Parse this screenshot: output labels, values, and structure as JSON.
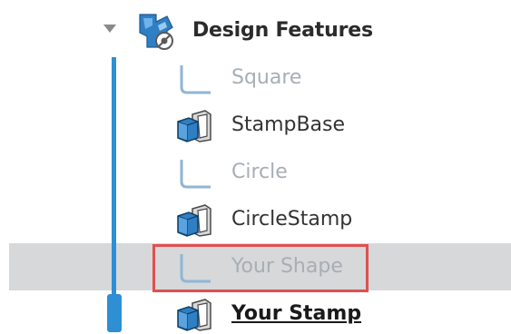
{
  "tree": {
    "folder": {
      "label": "Design Features",
      "icon": "design-features-folder-icon",
      "expanded": true
    },
    "items": [
      {
        "label": "Square",
        "type": "sketch",
        "icon": "sketch-icon",
        "suppressed": true
      },
      {
        "label": "StampBase",
        "type": "solid",
        "icon": "solid-body-icon",
        "suppressed": false
      },
      {
        "label": "Circle",
        "type": "sketch",
        "icon": "sketch-icon",
        "suppressed": true
      },
      {
        "label": "CircleStamp",
        "type": "solid",
        "icon": "solid-body-icon",
        "suppressed": false
      },
      {
        "label": "Your Shape",
        "type": "sketch",
        "icon": "sketch-icon",
        "suppressed": true,
        "selected": true,
        "annotated": true
      },
      {
        "label": "Your Stamp",
        "type": "solid",
        "icon": "solid-body-icon",
        "suppressed": false,
        "active": true
      }
    ]
  },
  "colors": {
    "tree_line": "#2e8fd4",
    "selection_bg": "#d6d8da",
    "annotation_border": "#e05050",
    "suppressed_text": "#a8aeb4"
  }
}
